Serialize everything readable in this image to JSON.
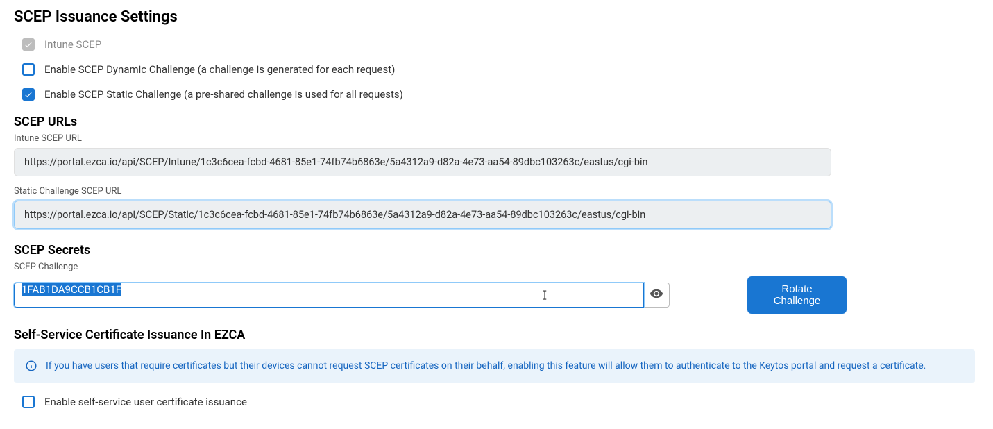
{
  "scep_issuance": {
    "title": "SCEP Issuance Settings",
    "intune_label": "Intune SCEP",
    "dynamic_label": "Enable SCEP Dynamic Challenge (a challenge is generated for each request)",
    "static_label": "Enable SCEP Static Challenge (a pre-shared challenge is used for all requests)"
  },
  "scep_urls": {
    "title": "SCEP URLs",
    "intune_url_label": "Intune SCEP URL",
    "intune_url_value": "https://portal.ezca.io/api/SCEP/Intune/1c3c6cea-fcbd-4681-85e1-74fb74b6863e/5a4312a9-d82a-4e73-aa54-89dbc103263c/eastus/cgi-bin",
    "static_url_label": "Static Challenge SCEP URL",
    "static_url_value": "https://portal.ezca.io/api/SCEP/Static/1c3c6cea-fcbd-4681-85e1-74fb74b6863e/5a4312a9-d82a-4e73-aa54-89dbc103263c/eastus/cgi-bin"
  },
  "scep_secrets": {
    "title": "SCEP Secrets",
    "challenge_label": "SCEP Challenge",
    "challenge_value": "1FAB1DA9CCB1CB1F",
    "rotate_label": "Rotate Challenge"
  },
  "self_service": {
    "title": "Self-Service Certificate Issuance In EZCA",
    "info_text": "If you have users that require certificates but their devices cannot request SCEP certificates on their behalf, enabling this feature will allow them to authenticate to the Keytos portal and request a certificate.",
    "enable_label": "Enable self-service user certificate issuance"
  }
}
